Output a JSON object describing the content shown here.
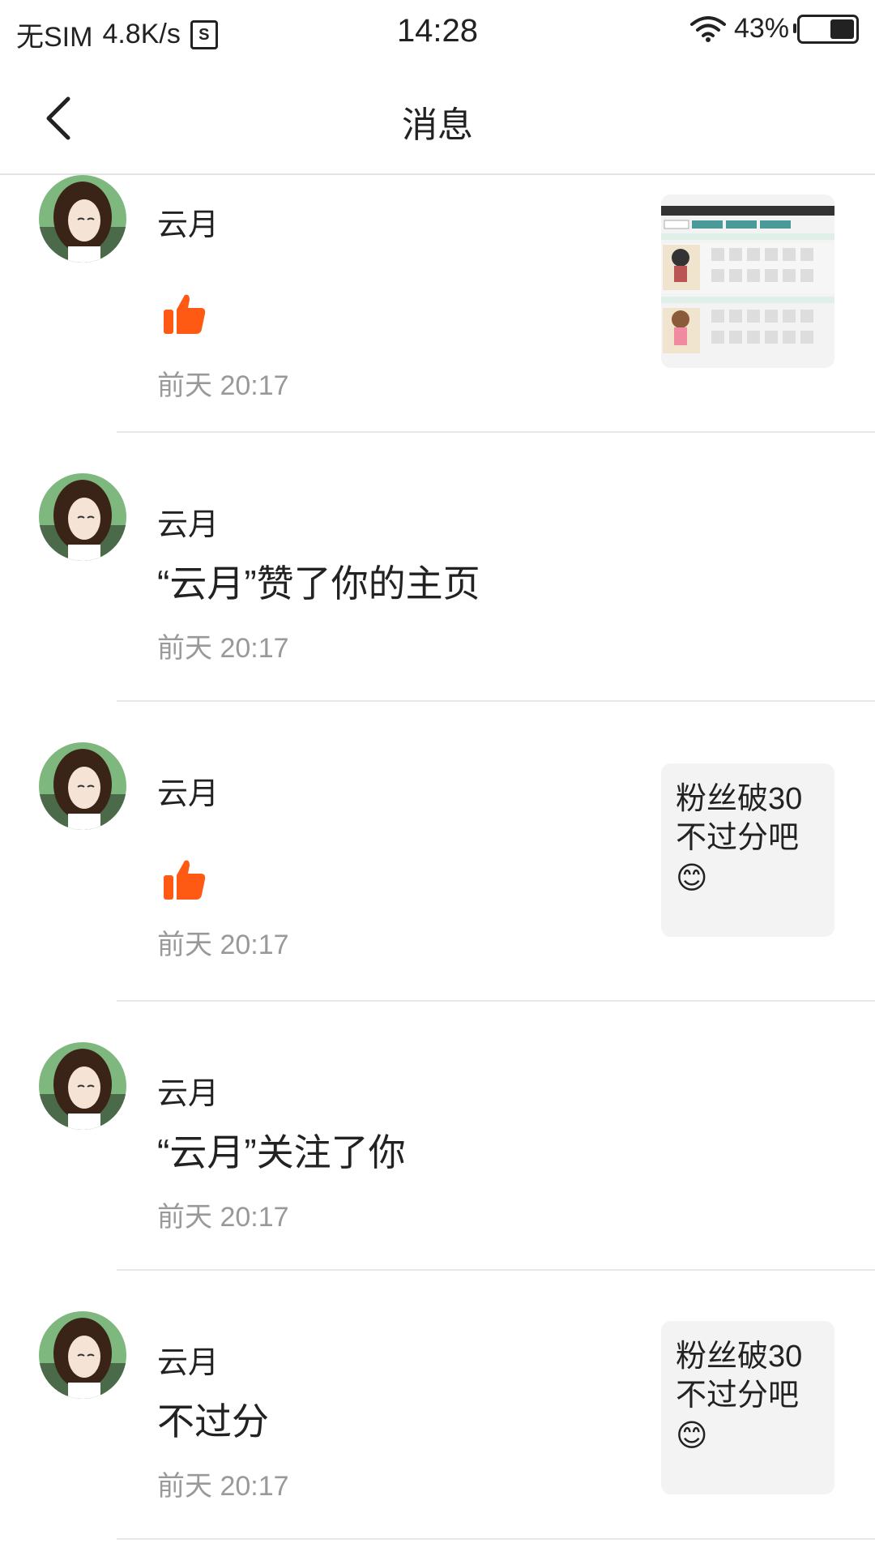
{
  "status_bar": {
    "carrier": "无SIM",
    "speed": "4.8K/s",
    "s_icon": "S",
    "time": "14:28",
    "battery": "43%"
  },
  "nav": {
    "title": "消息",
    "back_icon": "chevron-left-icon"
  },
  "colors": {
    "like": "#ff5a13",
    "time": "#999999",
    "thumb_bg": "#f3f3f3"
  },
  "items": [
    {
      "name": "云月",
      "content": "",
      "time": "前天 20:17",
      "type": "like",
      "thumb_text": "",
      "thumb_emoji": ""
    },
    {
      "name": "云月",
      "content": "“云月”赞了你的主页",
      "time": "前天 20:17",
      "type": "text",
      "thumb_text": "",
      "thumb_emoji": ""
    },
    {
      "name": "云月",
      "content": "",
      "time": "前天 20:17",
      "type": "like",
      "thumb_text": "粉丝破30不过分吧",
      "thumb_emoji": "😊"
    },
    {
      "name": "云月",
      "content": "“云月”关注了你",
      "time": "前天 20:17",
      "type": "text",
      "thumb_text": "",
      "thumb_emoji": ""
    },
    {
      "name": "云月",
      "content": "不过分",
      "time": "前天 20:17",
      "type": "text",
      "thumb_text": "粉丝破30不过分吧",
      "thumb_emoji": "😊"
    }
  ]
}
